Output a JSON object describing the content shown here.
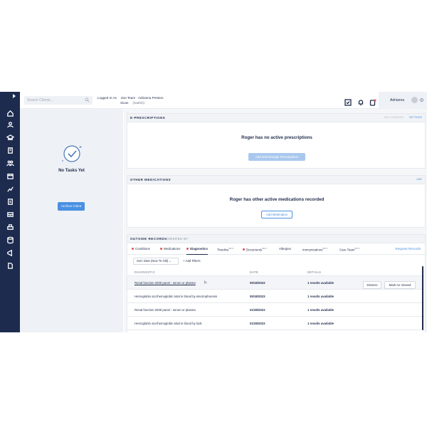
{
  "topbar": {
    "search_placeholder": "Search Clients...",
    "logged_in_label": "Logged In As",
    "team_line": "Zoe Team · Adrianna Preston",
    "role_line": "Sican",
    "switch_label": "(Switch)",
    "user_name": "Adrianna"
  },
  "tasks": {
    "empty_label": "No Tasks Yet",
    "archive_button": "Archive Client"
  },
  "eprescriptions": {
    "title": "E-PRESCRIPTIONS",
    "action_secondary": "ADD & MANAGE",
    "action_primary": "SETTINGS",
    "message": "Roger has no active prescriptions",
    "button": "Add and Manage Prescriptions"
  },
  "other_medications": {
    "title": "OTHER MEDICATIONS",
    "action": "ADD",
    "message": "Roger has other active medications recorded",
    "button": "Add Medication"
  },
  "outside_records": {
    "title": "OUTSIDE RECORDS",
    "powered_by": "POWERED BY",
    "tabs": [
      {
        "label": "Conditions",
        "dot": true,
        "beta": ""
      },
      {
        "label": "Medications",
        "dot": true,
        "beta": ""
      },
      {
        "label": "Diagnostics",
        "dot": true,
        "beta": ""
      },
      {
        "label": "Timeline",
        "dot": false,
        "beta": "BETA"
      },
      {
        "label": "Documents",
        "dot": true,
        "beta": "BETA"
      },
      {
        "label": "Allergies",
        "dot": false,
        "beta": ""
      },
      {
        "label": "Immunizations",
        "dot": false,
        "beta": "BETA"
      },
      {
        "label": "Care Team",
        "dot": false,
        "beta": "BETA"
      }
    ],
    "request_link": "Request Records",
    "sort_label": "Sort: Date (New To Old)",
    "add_filters": "+ Add Filters",
    "columns": {
      "diagnostic": "DIAGNOSTIC",
      "date": "DATE",
      "details": "DETAILS"
    },
    "rows": [
      {
        "diagnostic": "Renal function 2000 panel - serum or plasma",
        "date": "05/18/2023",
        "details": "1 results available"
      },
      {
        "diagnostic": "Hemoglobin a1c/hemoglobin total in blood by electrophoresis",
        "date": "05/18/2023",
        "details": "1 results available"
      },
      {
        "diagnostic": "Renal function 2000 panel - serum or plasma",
        "date": "01/28/2023",
        "details": "1 results available"
      },
      {
        "diagnostic": "Hemoglobin a1c/hemoglobin total in blood by hplc",
        "date": "01/28/2023",
        "details": "1 results available"
      }
    ],
    "row_actions": {
      "dismiss": "Dismiss",
      "mark_viewed": "Mark As Viewed"
    }
  }
}
